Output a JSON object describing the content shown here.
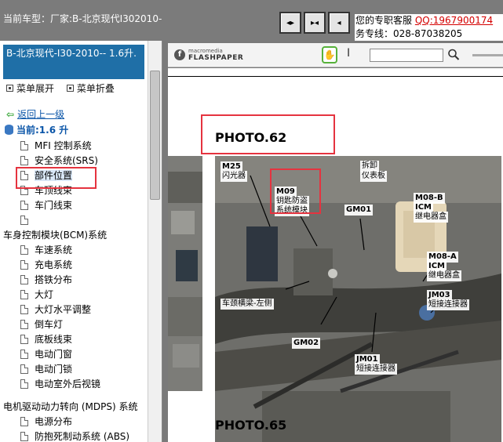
{
  "topbar": {
    "car_label": "当前车型：厂家:B-北京现代I302010-",
    "nav_buttons": [
      "prev",
      "split",
      "next"
    ],
    "service_line1": "您的专职客服",
    "qq": "QQ:1967900174",
    "service_line2": "务专线：028-87038205"
  },
  "left_panel": {
    "title": "B-北京现代-I30-2010-- 1.6升.",
    "expand_label": "菜单展开",
    "collapse_label": "菜单折叠",
    "back_label": "返回上一级",
    "current_label": "当前:1.6 升",
    "items_a": [
      "MFI 控制系统",
      "安全系统(SRS)",
      "部件位置",
      "车顶线束",
      "车门线束",
      ""
    ],
    "section1": "车身控制模块(BCM)系统",
    "items_b": [
      "车速系统",
      "充电系统",
      "搭铁分布",
      "大灯",
      "大灯水平调整",
      "倒车灯",
      "底板线束",
      "电动门窗",
      "电动门锁",
      "电动室外后视镜"
    ],
    "section2": "电机驱动动力转向 (MDPS) 系统",
    "items_c": [
      "电源分布",
      "防抱死制动系统 (ABS)"
    ]
  },
  "viewer": {
    "logo_top": "macromedia",
    "logo_bottom": "FLASHPAPER",
    "hand_icon": "hand-icon",
    "text_cursor_icon": "text-cursor-icon",
    "search_placeholder": "",
    "photo62_title": "PHOTO.62",
    "photo65_title": "PHOTO.65",
    "labels": {
      "m25": "M25",
      "m25_cn": "闪光器",
      "m09": "M09",
      "m09_cn1": "钥匙防盗",
      "m09_cn2": "系统模块",
      "remove": "拆卸",
      "panel": "仪表板",
      "gm01": "GM01",
      "m08b": "M08-B",
      "m08b_icm": "ICM",
      "m08b_cn": "继电器盒",
      "m08a": "M08-A",
      "m08a_icm": "ICM",
      "m08a_cn": "继电器盒",
      "jm03": "JM03",
      "jm03_cn": "短接连接器",
      "beam": "车颈横梁-左侧",
      "gm02": "GM02",
      "jm01": "JM01",
      "jm01_cn": "短接连接器"
    }
  },
  "colors": {
    "title_bg": "#1f6fa7",
    "highlight_red": "#e5333f",
    "link_blue": "#0a55a8"
  }
}
